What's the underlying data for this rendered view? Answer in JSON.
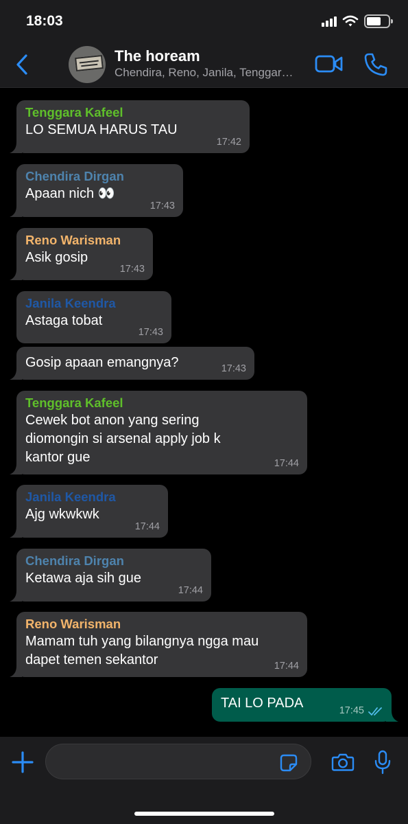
{
  "status_bar": {
    "time": "18:03"
  },
  "header": {
    "title": "The hoream",
    "subtitle": "Chendira, Reno, Janila, Tenggara, You"
  },
  "colors": {
    "tenggara": "#5fbf2a",
    "chendira": "#4e83ad",
    "reno": "#f2b46b",
    "janila": "#1f58a6",
    "accent": "#2b8cf5",
    "outgoing_bubble": "#005c4b",
    "incoming_bubble": "#363638"
  },
  "messages": [
    {
      "sender": "Tenggara Kafeel",
      "text": "LO SEMUA HARUS TAU",
      "time": "17:42"
    },
    {
      "sender": "Chendira Dirgan",
      "text": "Apaan nich 👀",
      "time": "17:43"
    },
    {
      "sender": "Reno Warisman",
      "text": "Asik gosip",
      "time": "17:43"
    },
    {
      "sender": "Janila Keendra",
      "text": "Astaga tobat",
      "time": "17:43"
    },
    {
      "sender": "",
      "text": "Gosip apaan emangnya?",
      "time": "17:43"
    },
    {
      "sender": "Tenggara Kafeel",
      "text": "Cewek bot anon yang sering\ndiomongin si arsenal apply job k\nkantor gue",
      "time": "17:44"
    },
    {
      "sender": "Janila Keendra",
      "text": "Ajg wkwkwk",
      "time": "17:44"
    },
    {
      "sender": "Chendira Dirgan",
      "text": "Ketawa aja sih gue",
      "time": "17:44"
    },
    {
      "sender": "Reno Warisman",
      "text": "Mamam tuh yang bilangnya ngga mau\ndapet temen sekantor",
      "time": "17:44"
    },
    {
      "sender": "You",
      "text": "TAI LO PADA",
      "time": "17:45",
      "status": "read"
    }
  ],
  "input": {
    "placeholder": ""
  },
  "icons": {
    "back": "chevron-left-icon",
    "video": "video-camera-icon",
    "call": "phone-icon",
    "add": "plus-icon",
    "sticker": "sticker-icon",
    "camera": "camera-icon",
    "mic": "microphone-icon"
  }
}
